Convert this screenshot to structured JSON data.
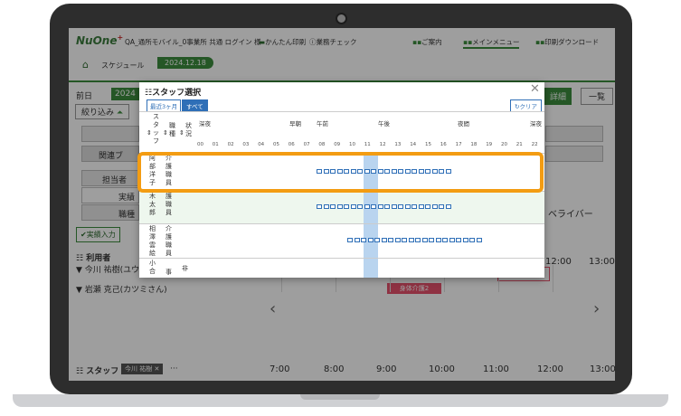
{
  "app": {
    "logo_text": "NuOne",
    "logo_plus": "+",
    "user_info": "QA_通所モバイル_0事業所 共通 ログイン 様",
    "print_label": "かんたん印刷",
    "check_label": "業務チェック",
    "info_label": "ご案内",
    "menu_label": "メインメニュー",
    "download_label": "印刷ダウンロード"
  },
  "breadcrumb": {
    "home_icon": "home-icon",
    "schedule": "スケジュール",
    "date": "2024.12.18"
  },
  "toolbar": {
    "prev": "前日",
    "date_short": "2024",
    "detail": "詳細",
    "list": "一覧",
    "narrow": "絞り込み"
  },
  "left_rows": [
    "関連ブ",
    "担当者",
    "実績",
    "職種"
  ],
  "right_label": "ベライバー",
  "record_button": "実績入力",
  "users": {
    "title": "利用者",
    "user1": "今川 祐樹(ユウ",
    "user2": "岩瀬 克己(カツミさん)",
    "care_chip": "身体介護2"
  },
  "times": [
    "7:00",
    "8:00",
    "9:00",
    "10:00",
    "11:00",
    "12:00",
    "13:00"
  ],
  "staff": {
    "title": "スタッフ",
    "chip": "今川 祐樹 ✕",
    "more": "···"
  },
  "modal": {
    "title": "スタッフ選択",
    "recent": "最近3ヶ月",
    "all": "すべて",
    "clear": "クリア",
    "col_staff": "スタッフ",
    "col_job": "職種",
    "col_status": "状況",
    "periods": [
      "深夜",
      "早朝",
      "午前",
      "午後",
      "夜間",
      "深夜"
    ],
    "hours": [
      "00",
      "01",
      "02",
      "03",
      "04",
      "05",
      "06",
      "07",
      "08",
      "09",
      "10",
      "11",
      "12",
      "13",
      "14",
      "15",
      "16",
      "17",
      "18",
      "19",
      "20",
      "21",
      "22"
    ],
    "staff_rows": [
      {
        "name": "阿部洋子",
        "job": "介護職員",
        "status": ""
      },
      {
        "name": "木太郎",
        "job": "護職員",
        "status": ""
      },
      {
        "name": "相澤雲絵",
        "job": "介護職員",
        "status": ""
      },
      {
        "name": "小合",
        "job": "事",
        "status": "非"
      }
    ]
  }
}
